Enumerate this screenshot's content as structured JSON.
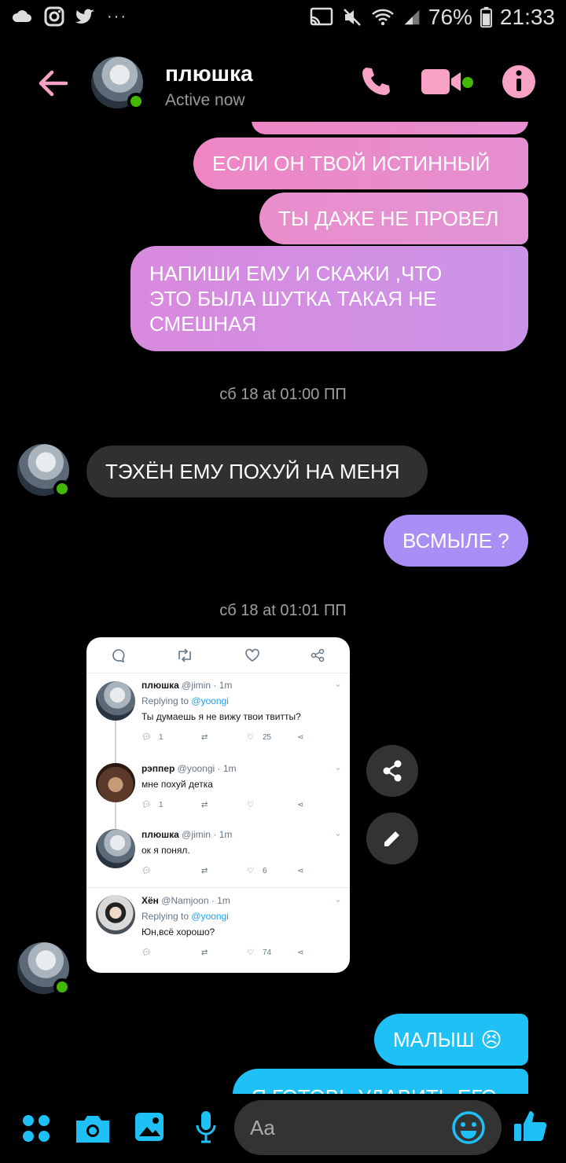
{
  "status_bar": {
    "battery": "76%",
    "time": "21:33",
    "left_icons": [
      "cloud-icon",
      "instagram-icon",
      "twitter-icon",
      "more-dots-icon"
    ],
    "right_icons": [
      "cast-icon",
      "mute-icon",
      "wifi-icon",
      "signal-icon",
      "battery-icon"
    ]
  },
  "header": {
    "name": "плюшка",
    "status": "Active now",
    "accent": "#f7a1c4",
    "online_color": "#44b700"
  },
  "messages": {
    "m1": "ЕСЛИ ОН ТВОЙ ИСТИННЫЙ",
    "m2": "ТЫ ДАЖЕ НЕ ПРОВЕЛ",
    "m3_line1": "НАПИШИ ЕМУ И СКАЖИ ,ЧТО",
    "m3_line2": "ЭТО БЫЛА ШУТКА ТАКАЯ НЕ",
    "m3_line3": "СМЕШНАЯ",
    "time1": "сб 18 at 01:00 ПП",
    "m4": "ТЭХЁН ЕМУ ПОХУЙ НА МЕНЯ",
    "m5": "ВСМЫЛЕ ?",
    "time2": "сб 18 at 01:01 ПП",
    "m6": "МАЛЫШ",
    "m6_emoji": "😣",
    "m7_partial": "Я ГОТОВЬ УДАВИТЬ ЕГО"
  },
  "tweet_card": {
    "tweets": [
      {
        "name": "плюшка",
        "handle": "@jimin",
        "time": "· 1m",
        "reply_prefix": "Replying to",
        "reply_to": "@yoongi",
        "text": "Ты думаешь я не вижу твои твитты?",
        "replies": "1",
        "likes": "25"
      },
      {
        "name": "рэппер",
        "handle": "@yoongi",
        "time": "· 1m",
        "text": "мне похуй детка",
        "replies": "1",
        "likes": ""
      },
      {
        "name": "плюшка",
        "handle": "@jimin",
        "time": "· 1m",
        "text": "ок я понял.",
        "replies": "",
        "likes": "6"
      },
      {
        "name": "Хён",
        "handle": "@Namjoon",
        "time": "· 1m",
        "reply_prefix": "Replying to",
        "reply_to": "@yoongi",
        "text": "Юн,всё хорошо?",
        "replies": "",
        "likes": "74"
      }
    ]
  },
  "composer": {
    "placeholder": "Aa"
  },
  "colors": {
    "messenger_blue": "#1ec0f5",
    "pink_start": "#ef8ac3",
    "purple_end": "#cd94ea",
    "violet": "#a98ef5"
  }
}
